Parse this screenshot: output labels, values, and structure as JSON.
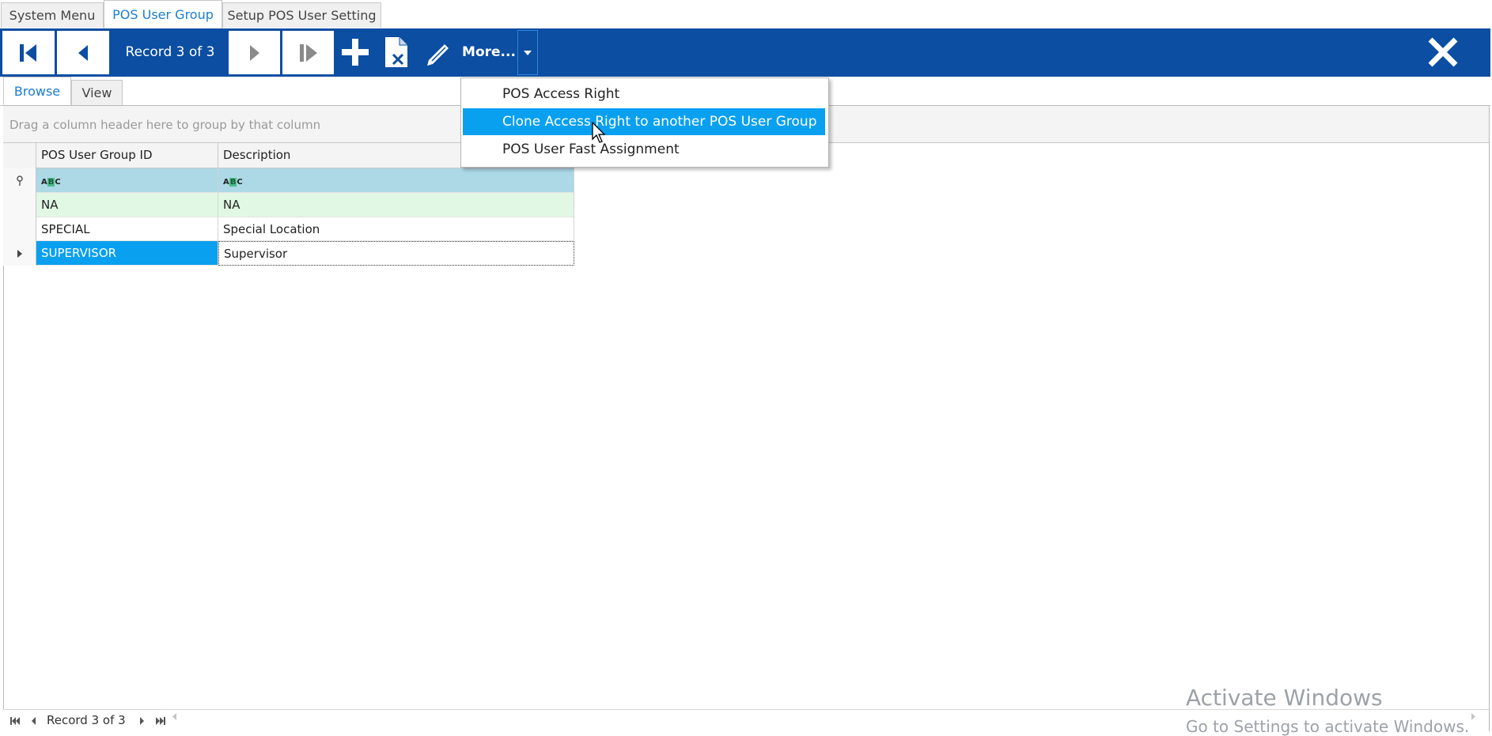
{
  "doc_tabs": [
    {
      "label": "System Menu"
    },
    {
      "label": "POS User Group"
    },
    {
      "label": "Setup POS User Setting"
    }
  ],
  "toolbar": {
    "record_label": "Record 3 of 3",
    "more_label": "More...",
    "accent_color": "#0b4ea2",
    "icons": [
      "first-record-icon",
      "previous-record-icon",
      "next-record-icon",
      "last-record-icon",
      "add-icon",
      "delete-document-icon",
      "edit-pencil-icon",
      "dropdown-arrow-icon",
      "close-icon"
    ]
  },
  "sub_tabs": [
    {
      "label": "Browse"
    },
    {
      "label": "View"
    }
  ],
  "grid": {
    "group_panel_text": "Drag a column header here to group by that column",
    "columns": [
      "POS User Group ID",
      "Description"
    ],
    "rows": [
      {
        "id": "NA",
        "description": "NA"
      },
      {
        "id": "SPECIAL",
        "description": "Special Location"
      },
      {
        "id": "SUPERVISOR",
        "description": "Supervisor"
      }
    ],
    "selected_row": 2
  },
  "more_menu": {
    "items": [
      {
        "label": "POS Access Right"
      },
      {
        "label": "Clone Access Right to another POS User Group"
      },
      {
        "label": "POS User Fast Assignment"
      }
    ],
    "highlighted_item": 1
  },
  "pager": {
    "record_label": "Record 3 of 3"
  },
  "watermark": {
    "line1": "Activate Windows",
    "line2": "Go to Settings to activate Windows."
  }
}
